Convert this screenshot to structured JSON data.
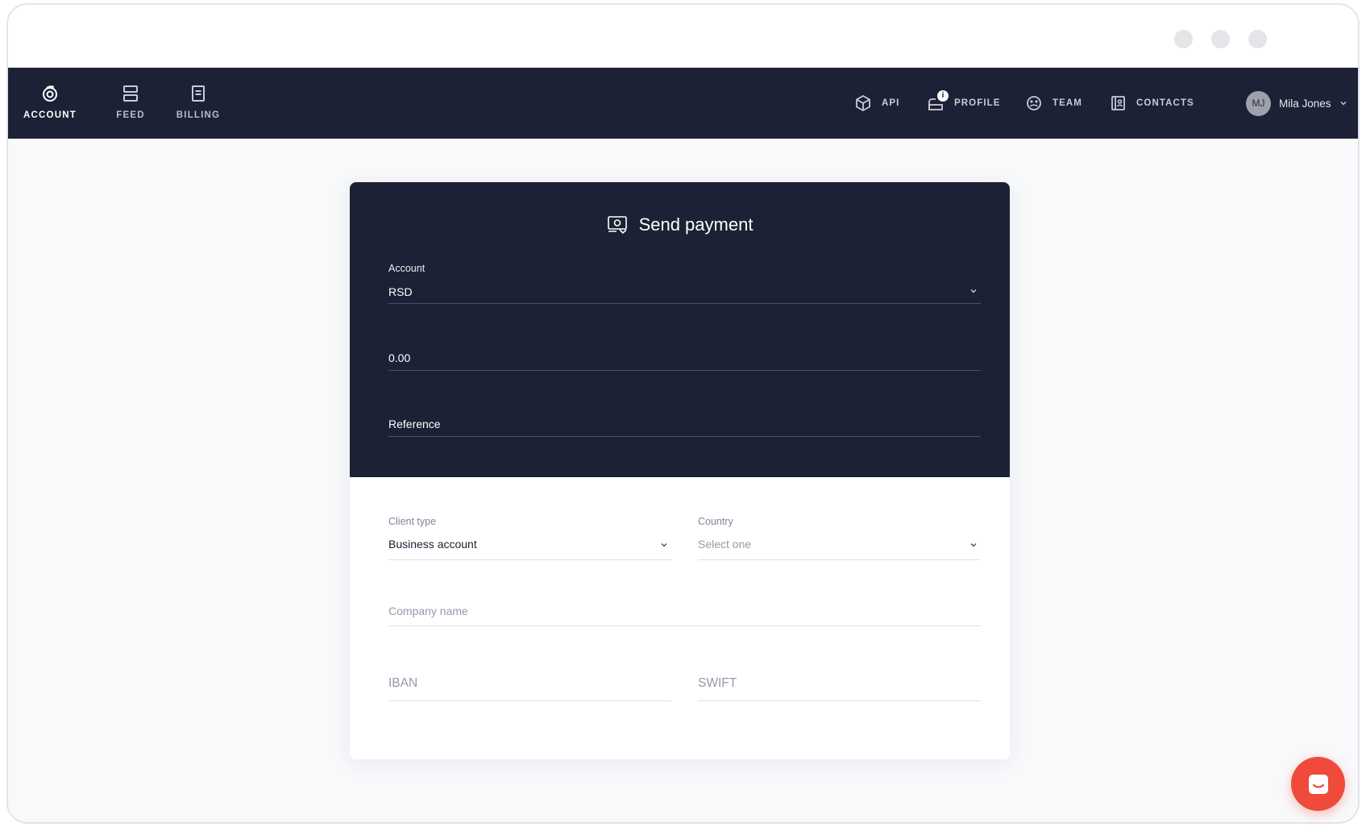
{
  "nav": {
    "tabs": [
      {
        "label": "ACCOUNT",
        "icon": "account-icon",
        "active": true
      },
      {
        "label": "FEED",
        "icon": "feed-icon",
        "active": false
      },
      {
        "label": "BILLING",
        "icon": "billing-icon",
        "active": false
      }
    ],
    "right": [
      {
        "label": "API",
        "icon": "api-icon"
      },
      {
        "label": "PROFILE",
        "icon": "profile-icon",
        "badge": "i"
      },
      {
        "label": "TEAM",
        "icon": "team-icon"
      },
      {
        "label": "CONTACTS",
        "icon": "contacts-icon"
      }
    ],
    "user": {
      "initials": "MJ",
      "name": "Mila Jones"
    }
  },
  "card": {
    "title": "Send payment",
    "title_icon": "payment-icon",
    "account": {
      "label": "Account",
      "value": "RSD"
    },
    "amount": {
      "value": "0.00"
    },
    "reference": {
      "placeholder": "Reference"
    },
    "client_type": {
      "label": "Client type",
      "value": "Business account"
    },
    "country": {
      "label": "Country",
      "placeholder": "Select one"
    },
    "company_name": {
      "placeholder": "Company name"
    },
    "iban": {
      "placeholder": "IBAN"
    },
    "swift": {
      "placeholder": "SWIFT"
    }
  },
  "colors": {
    "nav_bg": "#1d2135",
    "card_top_bg": "#1d2135",
    "page_bg": "#f8f9fb",
    "chat_button": "#f04a3a"
  },
  "chat": {
    "icon": "chat-icon"
  }
}
